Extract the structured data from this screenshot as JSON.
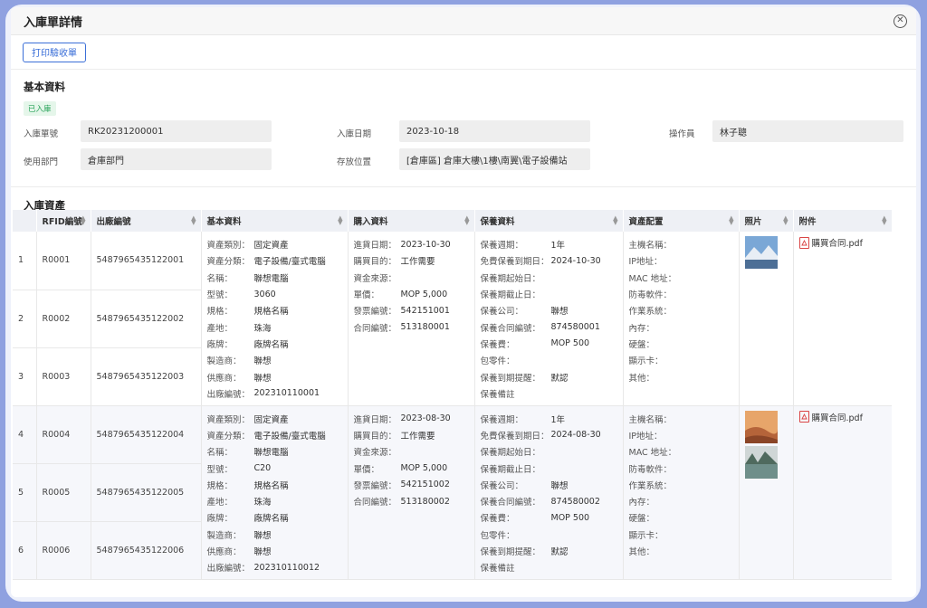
{
  "modal": {
    "title": "入庫單詳情",
    "close_icon": "close-circle-icon"
  },
  "toolbar": {
    "print_label": "打印驗收單"
  },
  "basic": {
    "title": "基本資料",
    "status": "已入庫",
    "fields": {
      "order_no_label": "入庫單號",
      "order_no": "RK20231200001",
      "date_label": "入庫日期",
      "date": "2023-10-18",
      "operator_label": "操作員",
      "operator": "林子聰",
      "dept_label": "使用部門",
      "dept": "倉庫部門",
      "location_label": "存放位置",
      "location": "[倉庫區] 倉庫大樓\\1樓\\南翼\\電子設備站"
    }
  },
  "assets": {
    "title": "入庫資產",
    "columns": [
      "",
      "RFID編號",
      "出廠編號",
      "基本資料",
      "購入資料",
      "保養資料",
      "資產配置",
      "照片",
      "附件"
    ],
    "rows": [
      {
        "index": "1",
        "rfid": "R0001",
        "serial": "5487965435122001"
      },
      {
        "index": "2",
        "rfid": "R0002",
        "serial": "5487965435122002"
      },
      {
        "index": "3",
        "rfid": "R0003",
        "serial": "5487965435122003"
      },
      {
        "index": "4",
        "rfid": "R0004",
        "serial": "5487965435122004"
      },
      {
        "index": "5",
        "rfid": "R0005",
        "serial": "5487965435122005"
      },
      {
        "index": "6",
        "rfid": "R0006",
        "serial": "5487965435122006"
      }
    ],
    "groups": [
      {
        "basic": [
          [
            "資產類別：",
            "固定資產"
          ],
          [
            "資產分類：",
            "電子設備/臺式電腦"
          ],
          [
            "名稱：",
            "聯想電腦"
          ],
          [
            "型號：",
            "3060"
          ],
          [
            "規格：",
            "規格名稱"
          ],
          [
            "產地：",
            "珠海"
          ],
          [
            "廠牌：",
            "廠牌名稱"
          ],
          [
            "製造商：",
            "聯想"
          ],
          [
            "供應商：",
            "聯想"
          ],
          [
            "出廠編號：",
            "202310110001"
          ]
        ],
        "purchase": [
          [
            "進貨日期：",
            "2023-10-30"
          ],
          [
            "購買目的：",
            "工作需要"
          ],
          [
            "資金來源：",
            ""
          ],
          [
            "單價：",
            "MOP 5,000"
          ],
          [
            "發票編號：",
            "542151001"
          ],
          [
            "合同編號：",
            "513180001"
          ]
        ],
        "maintenance": [
          [
            "保養週期：",
            "1年"
          ],
          [
            "免費保養到期日：",
            "2024-10-30"
          ],
          [
            "保養期起始日：",
            ""
          ],
          [
            "保養期截止日：",
            ""
          ],
          [
            "保養公司：",
            "聯想"
          ],
          [
            "保養合同編號：",
            "874580001"
          ],
          [
            "保養費：",
            "MOP 500"
          ],
          [
            "包零件：",
            ""
          ],
          [
            "保養到期提醒：",
            "默認"
          ],
          [
            "保養備註",
            ""
          ]
        ],
        "config": [
          [
            "主機名稱：",
            ""
          ],
          [
            "IP地址：",
            ""
          ],
          [
            "MAC 地址：",
            ""
          ],
          [
            "防毒軟件：",
            ""
          ],
          [
            "作業系統：",
            ""
          ],
          [
            "內存：",
            ""
          ],
          [
            "硬盤：",
            ""
          ],
          [
            "顯示卡：",
            ""
          ],
          [
            "其他：",
            ""
          ]
        ],
        "photos": [
          "mountain-lake"
        ],
        "attachment": "購買合同.pdf"
      },
      {
        "basic": [
          [
            "資產類別：",
            "固定資產"
          ],
          [
            "資產分類：",
            "電子設備/臺式電腦"
          ],
          [
            "名稱：",
            "聯想電腦"
          ],
          [
            "型號：",
            "C20"
          ],
          [
            "規格：",
            "規格名稱"
          ],
          [
            "產地：",
            "珠海"
          ],
          [
            "廠牌：",
            "廠牌名稱"
          ],
          [
            "製造商：",
            "聯想"
          ],
          [
            "供應商：",
            "聯想"
          ],
          [
            "出廠編號：",
            "202310110012"
          ]
        ],
        "purchase": [
          [
            "進貨日期：",
            "2023-08-30"
          ],
          [
            "購買目的：",
            "工作需要"
          ],
          [
            "資金來源：",
            ""
          ],
          [
            "單價：",
            "MOP 5,000"
          ],
          [
            "發票編號：",
            "542151002"
          ],
          [
            "合同編號：",
            "513180002"
          ]
        ],
        "maintenance": [
          [
            "保養週期：",
            "1年"
          ],
          [
            "免費保養到期日：",
            "2024-08-30"
          ],
          [
            "保養期起始日：",
            ""
          ],
          [
            "保養期截止日：",
            ""
          ],
          [
            "保養公司：",
            "聯想"
          ],
          [
            "保養合同編號：",
            "874580002"
          ],
          [
            "保養費：",
            "MOP 500"
          ],
          [
            "包零件：",
            ""
          ],
          [
            "保養到期提醒：",
            "默認"
          ],
          [
            "保養備註",
            ""
          ]
        ],
        "config": [
          [
            "主機名稱：",
            ""
          ],
          [
            "IP地址：",
            ""
          ],
          [
            "MAC 地址：",
            ""
          ],
          [
            "防毒軟件：",
            ""
          ],
          [
            "作業系統：",
            ""
          ],
          [
            "內存：",
            ""
          ],
          [
            "硬盤：",
            ""
          ],
          [
            "顯示卡：",
            ""
          ],
          [
            "其他：",
            ""
          ]
        ],
        "photos": [
          "desert-dunes",
          "forest-lake"
        ],
        "attachment": "購買合同.pdf"
      }
    ]
  }
}
